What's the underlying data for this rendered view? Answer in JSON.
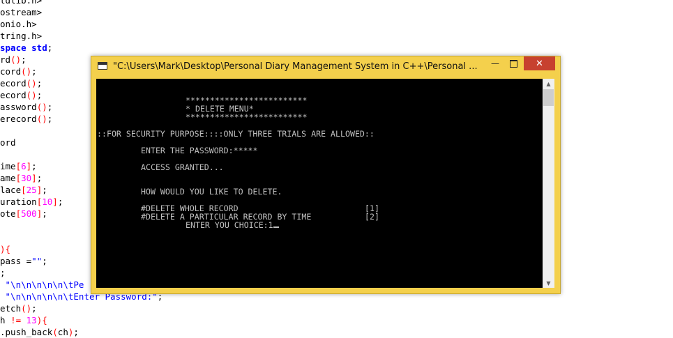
{
  "editor": {
    "lines": [
      [
        "tdlib.h>"
      ],
      [
        "ostream>"
      ],
      [
        "onio.h>"
      ],
      [
        "tring.h>"
      ],
      [
        "space std;"
      ],
      [
        "rd();"
      ],
      [
        "cord();"
      ],
      [
        "ecord();"
      ],
      [
        "ecord();"
      ],
      [
        "assword();"
      ],
      [
        "erecord();"
      ],
      [
        ""
      ],
      [
        "ord"
      ],
      [
        ""
      ],
      [
        "ime[6];"
      ],
      [
        "ame[30];"
      ],
      [
        "lace[25];"
      ],
      [
        "uration[10];"
      ],
      [
        "ote[500];"
      ],
      [
        ""
      ],
      [
        ""
      ],
      [
        "){"
      ],
      [
        "pass =\"\";"
      ],
      [
        ";"
      ],
      [
        " \"\\n\\n\\n\\n\\n\\tPe"
      ],
      [
        " \"\\n\\n\\n\\n\\n\\tEnter Password:\";"
      ],
      [
        "etch();"
      ],
      [
        "h != 13){"
      ],
      [
        ".push_back(ch);"
      ]
    ]
  },
  "window": {
    "title": "\"C:\\Users\\Mark\\Desktop\\Personal Diary Management System in C++\\Personal ...",
    "minimize_icon": "minimize-icon",
    "maximize_icon": "maximize-icon",
    "close_icon": "close-icon"
  },
  "console": {
    "stars_top": "*************************",
    "menu_title": "* DELETE MENU*",
    "stars_bottom": "*************************",
    "security_line": "::FOR SECURITY PURPOSE::::ONLY THREE TRIALS ARE ALLOWED::",
    "password_prompt": "ENTER THE PASSWORD:*****",
    "access_granted": "ACCESS GRANTED...",
    "how_delete": "HOW WOULD YOU LIKE TO DELETE.",
    "option1_label": "#DELETE WHOLE RECORD",
    "option1_key": "[1]",
    "option2_label": "#DELETE A PARTICULAR RECORD BY TIME",
    "option2_key": "[2]",
    "choice_prompt": "ENTER YOU CHOICE:1"
  },
  "colors": {
    "window_frame": "#f4d04c",
    "close_button": "#c7412f",
    "console_bg": "#000000",
    "console_text": "#c0c0c0"
  }
}
